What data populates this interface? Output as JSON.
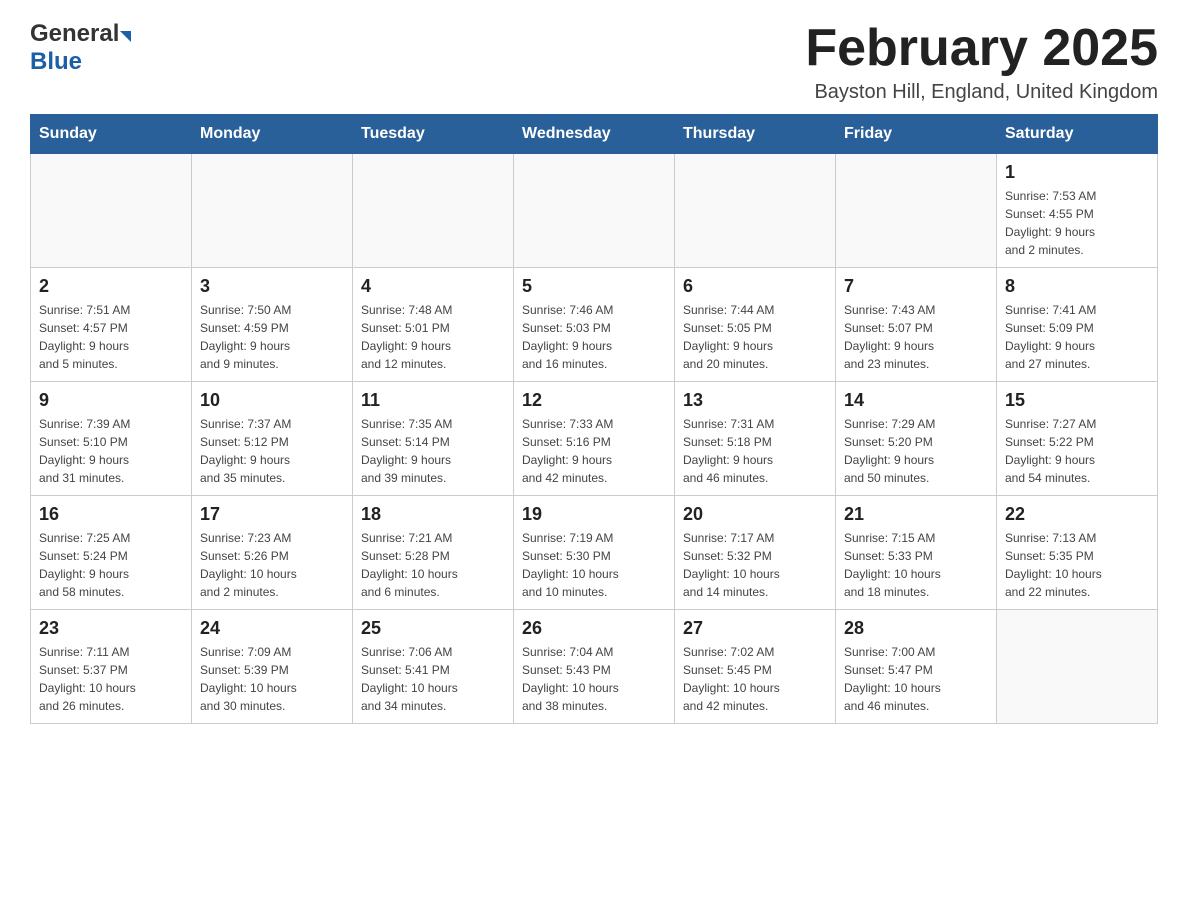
{
  "header": {
    "title": "February 2025",
    "subtitle": "Bayston Hill, England, United Kingdom",
    "logo_general": "General",
    "logo_blue": "Blue"
  },
  "weekdays": [
    "Sunday",
    "Monday",
    "Tuesday",
    "Wednesday",
    "Thursday",
    "Friday",
    "Saturday"
  ],
  "weeks": [
    [
      {
        "day": "",
        "info": ""
      },
      {
        "day": "",
        "info": ""
      },
      {
        "day": "",
        "info": ""
      },
      {
        "day": "",
        "info": ""
      },
      {
        "day": "",
        "info": ""
      },
      {
        "day": "",
        "info": ""
      },
      {
        "day": "1",
        "info": "Sunrise: 7:53 AM\nSunset: 4:55 PM\nDaylight: 9 hours\nand 2 minutes."
      }
    ],
    [
      {
        "day": "2",
        "info": "Sunrise: 7:51 AM\nSunset: 4:57 PM\nDaylight: 9 hours\nand 5 minutes."
      },
      {
        "day": "3",
        "info": "Sunrise: 7:50 AM\nSunset: 4:59 PM\nDaylight: 9 hours\nand 9 minutes."
      },
      {
        "day": "4",
        "info": "Sunrise: 7:48 AM\nSunset: 5:01 PM\nDaylight: 9 hours\nand 12 minutes."
      },
      {
        "day": "5",
        "info": "Sunrise: 7:46 AM\nSunset: 5:03 PM\nDaylight: 9 hours\nand 16 minutes."
      },
      {
        "day": "6",
        "info": "Sunrise: 7:44 AM\nSunset: 5:05 PM\nDaylight: 9 hours\nand 20 minutes."
      },
      {
        "day": "7",
        "info": "Sunrise: 7:43 AM\nSunset: 5:07 PM\nDaylight: 9 hours\nand 23 minutes."
      },
      {
        "day": "8",
        "info": "Sunrise: 7:41 AM\nSunset: 5:09 PM\nDaylight: 9 hours\nand 27 minutes."
      }
    ],
    [
      {
        "day": "9",
        "info": "Sunrise: 7:39 AM\nSunset: 5:10 PM\nDaylight: 9 hours\nand 31 minutes."
      },
      {
        "day": "10",
        "info": "Sunrise: 7:37 AM\nSunset: 5:12 PM\nDaylight: 9 hours\nand 35 minutes."
      },
      {
        "day": "11",
        "info": "Sunrise: 7:35 AM\nSunset: 5:14 PM\nDaylight: 9 hours\nand 39 minutes."
      },
      {
        "day": "12",
        "info": "Sunrise: 7:33 AM\nSunset: 5:16 PM\nDaylight: 9 hours\nand 42 minutes."
      },
      {
        "day": "13",
        "info": "Sunrise: 7:31 AM\nSunset: 5:18 PM\nDaylight: 9 hours\nand 46 minutes."
      },
      {
        "day": "14",
        "info": "Sunrise: 7:29 AM\nSunset: 5:20 PM\nDaylight: 9 hours\nand 50 minutes."
      },
      {
        "day": "15",
        "info": "Sunrise: 7:27 AM\nSunset: 5:22 PM\nDaylight: 9 hours\nand 54 minutes."
      }
    ],
    [
      {
        "day": "16",
        "info": "Sunrise: 7:25 AM\nSunset: 5:24 PM\nDaylight: 9 hours\nand 58 minutes."
      },
      {
        "day": "17",
        "info": "Sunrise: 7:23 AM\nSunset: 5:26 PM\nDaylight: 10 hours\nand 2 minutes."
      },
      {
        "day": "18",
        "info": "Sunrise: 7:21 AM\nSunset: 5:28 PM\nDaylight: 10 hours\nand 6 minutes."
      },
      {
        "day": "19",
        "info": "Sunrise: 7:19 AM\nSunset: 5:30 PM\nDaylight: 10 hours\nand 10 minutes."
      },
      {
        "day": "20",
        "info": "Sunrise: 7:17 AM\nSunset: 5:32 PM\nDaylight: 10 hours\nand 14 minutes."
      },
      {
        "day": "21",
        "info": "Sunrise: 7:15 AM\nSunset: 5:33 PM\nDaylight: 10 hours\nand 18 minutes."
      },
      {
        "day": "22",
        "info": "Sunrise: 7:13 AM\nSunset: 5:35 PM\nDaylight: 10 hours\nand 22 minutes."
      }
    ],
    [
      {
        "day": "23",
        "info": "Sunrise: 7:11 AM\nSunset: 5:37 PM\nDaylight: 10 hours\nand 26 minutes."
      },
      {
        "day": "24",
        "info": "Sunrise: 7:09 AM\nSunset: 5:39 PM\nDaylight: 10 hours\nand 30 minutes."
      },
      {
        "day": "25",
        "info": "Sunrise: 7:06 AM\nSunset: 5:41 PM\nDaylight: 10 hours\nand 34 minutes."
      },
      {
        "day": "26",
        "info": "Sunrise: 7:04 AM\nSunset: 5:43 PM\nDaylight: 10 hours\nand 38 minutes."
      },
      {
        "day": "27",
        "info": "Sunrise: 7:02 AM\nSunset: 5:45 PM\nDaylight: 10 hours\nand 42 minutes."
      },
      {
        "day": "28",
        "info": "Sunrise: 7:00 AM\nSunset: 5:47 PM\nDaylight: 10 hours\nand 46 minutes."
      },
      {
        "day": "",
        "info": ""
      }
    ]
  ]
}
